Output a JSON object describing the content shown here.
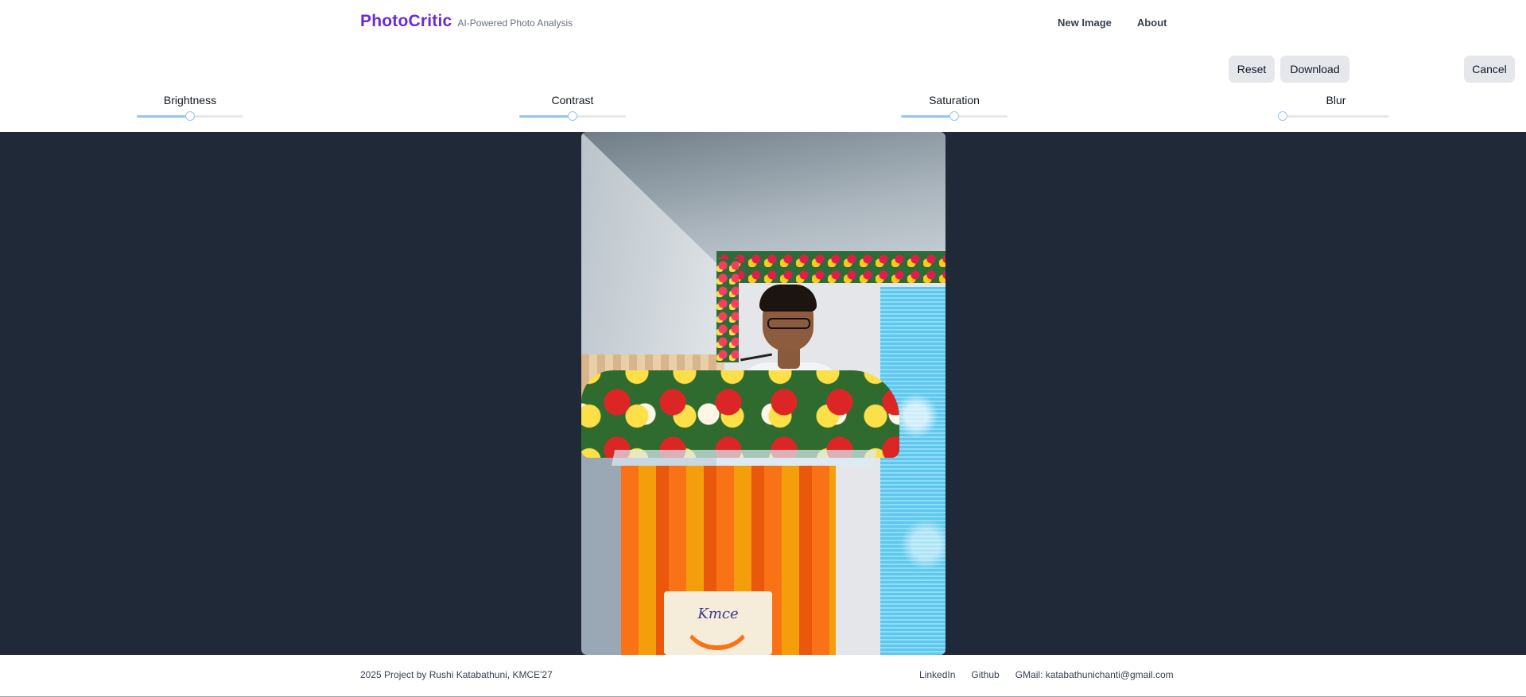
{
  "header": {
    "brand_name": "PhotoCritic",
    "brand_tagline": "AI-Powered Photo Analysis",
    "nav": [
      {
        "label": "New Image"
      },
      {
        "label": "About"
      }
    ]
  },
  "actions": {
    "reset_label": "Reset",
    "download_label": "Download",
    "cancel_label": "Cancel"
  },
  "sliders": [
    {
      "label": "Brightness",
      "value_fraction": 0.5
    },
    {
      "label": "Contrast",
      "value_fraction": 0.5
    },
    {
      "label": "Saturation",
      "value_fraction": 0.5
    },
    {
      "label": "Blur",
      "value_fraction": 0.0
    }
  ],
  "photo": {
    "sign_text": "Kmce"
  },
  "footer": {
    "credit": "2025 Project by Rushi Katabathuni, KMCE'27",
    "links": [
      {
        "label": "LinkedIn"
      },
      {
        "label": "Github"
      },
      {
        "label": "GMail: katabathunichanti@gmail.com"
      }
    ]
  },
  "colors": {
    "brand": "#6d28d9",
    "stage_background": "#1f2937",
    "slider_accent": "#93c5fd",
    "button_background": "#e5e7eb"
  }
}
